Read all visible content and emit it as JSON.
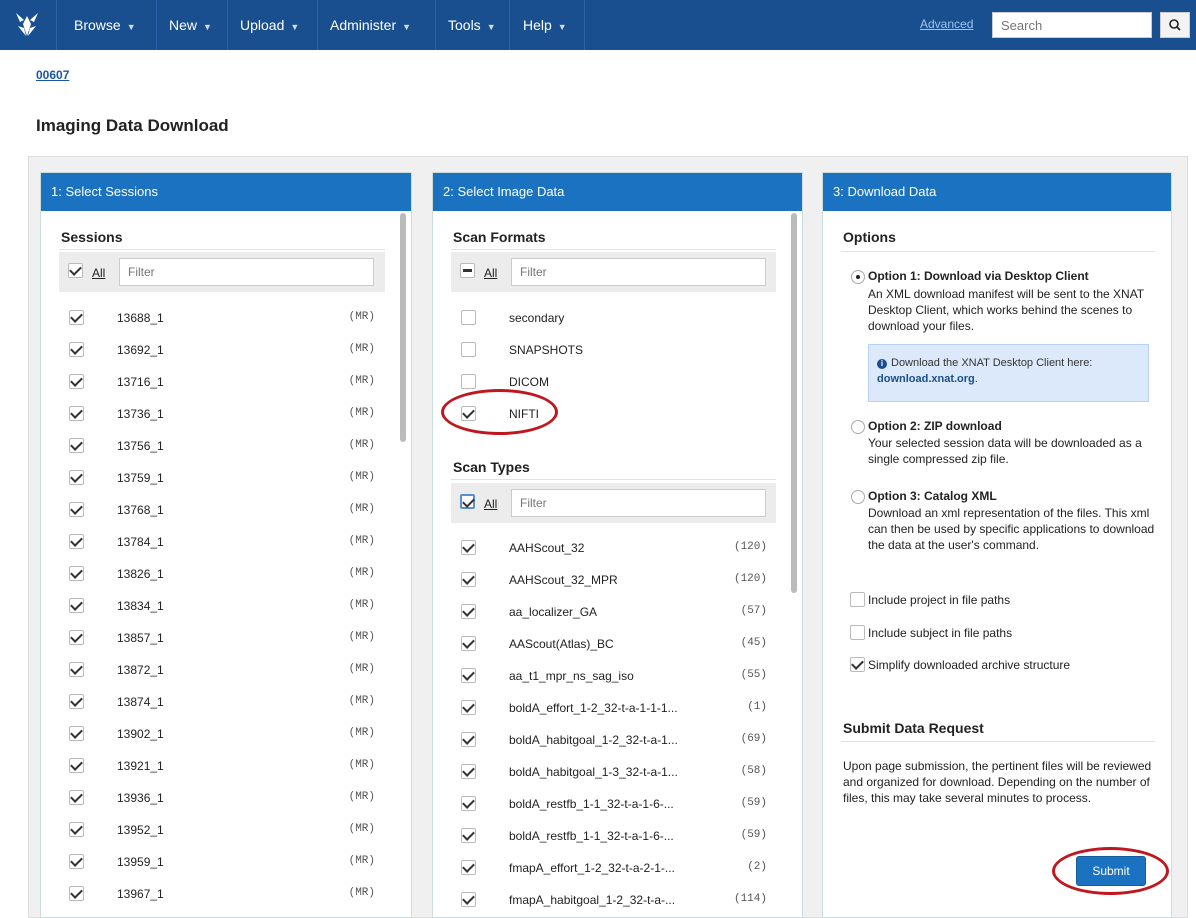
{
  "nav": {
    "menus": [
      {
        "label": "Browse"
      },
      {
        "label": "New"
      },
      {
        "label": "Upload"
      },
      {
        "label": "Administer"
      },
      {
        "label": "Tools"
      },
      {
        "label": "Help"
      }
    ],
    "advanced_link": "Advanced",
    "search_placeholder": "Search"
  },
  "breadcrumb": "00607",
  "page_title": "Imaging Data Download",
  "panel1": {
    "header": "1: Select Sessions",
    "section_title": "Sessions",
    "all_label": "All",
    "filter_placeholder": "Filter",
    "sessions": [
      {
        "id": "13688_1",
        "type": "(MR)"
      },
      {
        "id": "13692_1",
        "type": "(MR)"
      },
      {
        "id": "13716_1",
        "type": "(MR)"
      },
      {
        "id": "13736_1",
        "type": "(MR)"
      },
      {
        "id": "13756_1",
        "type": "(MR)"
      },
      {
        "id": "13759_1",
        "type": "(MR)"
      },
      {
        "id": "13768_1",
        "type": "(MR)"
      },
      {
        "id": "13784_1",
        "type": "(MR)"
      },
      {
        "id": "13826_1",
        "type": "(MR)"
      },
      {
        "id": "13834_1",
        "type": "(MR)"
      },
      {
        "id": "13857_1",
        "type": "(MR)"
      },
      {
        "id": "13872_1",
        "type": "(MR)"
      },
      {
        "id": "13874_1",
        "type": "(MR)"
      },
      {
        "id": "13902_1",
        "type": "(MR)"
      },
      {
        "id": "13921_1",
        "type": "(MR)"
      },
      {
        "id": "13936_1",
        "type": "(MR)"
      },
      {
        "id": "13952_1",
        "type": "(MR)"
      },
      {
        "id": "13959_1",
        "type": "(MR)"
      },
      {
        "id": "13967_1",
        "type": "(MR)"
      }
    ]
  },
  "panel2": {
    "header": "2: Select Image Data",
    "formats_title": "Scan Formats",
    "all_label": "All",
    "filter_placeholder": "Filter",
    "formats": [
      {
        "label": "secondary",
        "checked": false
      },
      {
        "label": "SNAPSHOTS",
        "checked": false
      },
      {
        "label": "DICOM",
        "checked": false
      },
      {
        "label": "NIFTI",
        "checked": true
      }
    ],
    "types_title": "Scan Types",
    "types": [
      {
        "label": "AAHScout_32",
        "count": "(120)"
      },
      {
        "label": "AAHScout_32_MPR",
        "count": "(120)"
      },
      {
        "label": "aa_localizer_GA",
        "count": "(57)"
      },
      {
        "label": "AAScout(Atlas)_BC",
        "count": "(45)"
      },
      {
        "label": "aa_t1_mpr_ns_sag_iso",
        "count": "(55)"
      },
      {
        "label": "boldA_effort_1-2_32-t-a-1-1-1...",
        "count": "(1)"
      },
      {
        "label": "boldA_habitgoal_1-2_32-t-a-1...",
        "count": "(69)"
      },
      {
        "label": "boldA_habitgoal_1-3_32-t-a-1...",
        "count": "(58)"
      },
      {
        "label": "boldA_restfb_1-1_32-t-a-1-6-...",
        "count": "(59)"
      },
      {
        "label": "boldA_restfb_1-1_32-t-a-1-6-...",
        "count": "(59)"
      },
      {
        "label": "fmapA_effort_1-2_32-t-a-2-1-...",
        "count": "(2)"
      },
      {
        "label": "fmapA_habitgoal_1-2_32-t-a-...",
        "count": "(114)"
      }
    ]
  },
  "panel3": {
    "header": "3: Download Data",
    "options_title": "Options",
    "option1_title": "Option 1: Download via Desktop Client",
    "option1_desc": "An XML download manifest will be sent to the XNAT Desktop Client, which works behind the scenes to download your files.",
    "info_text": "Download the XNAT Desktop Client here:",
    "info_link": "download.xnat.org",
    "option2_title": "Option 2: ZIP download",
    "option2_desc": "Your selected session data will be downloaded as a single compressed zip file.",
    "option3_title": "Option 3: Catalog XML",
    "option3_desc": "Download an xml representation of the files. This xml can then be used by specific applications to download the data at the user's command.",
    "check_project": "Include project in file paths",
    "check_subject": "Include subject in file paths",
    "check_simplify": "Simplify downloaded archive structure",
    "submit_title": "Submit Data Request",
    "submit_desc": "Upon page submission, the pertinent files will be reviewed and organized for download. Depending on the number of files, this may take several minutes to process.",
    "submit_button": "Submit"
  }
}
